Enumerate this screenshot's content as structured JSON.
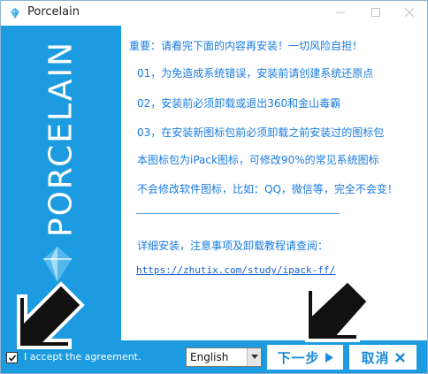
{
  "window": {
    "title": "Porcelain"
  },
  "sidebar": {
    "brand": "PORCELAIN"
  },
  "content": {
    "heading": "重要：请看完下面的内容再安装！一切风险自担！",
    "lines": [
      "01，为免造成系统错误，安装前请创建系统还原点",
      "02，安装前必须卸载或退出360和金山毒霸",
      "03，在安装新图标包前必须卸载之前安装过的图标包",
      "本图标包为iPack图标，可修改90%的常见系统图标",
      "不会修改软件图标，比如：QQ，微信等，完全不会变！"
    ],
    "details": "详细安装，注意事项及卸载教程请查阅：",
    "link": "https://zhutix.com/study/ipack-ff/"
  },
  "footer": {
    "accept_label": "I accept the agreement.",
    "accept_checked": true,
    "language": "English",
    "next_label": "下一步",
    "cancel_label": "取消"
  },
  "icons": {
    "app": "app-logo-icon",
    "minimize": "minimize-icon",
    "maximize": "maximize-icon",
    "close": "close-icon",
    "checkmark": "checkmark-icon",
    "dropdown": "chevron-down-icon",
    "next": "play-triangle-icon",
    "cancel": "x-icon"
  },
  "colors": {
    "accent": "#1d9be0",
    "text_blue": "#1a7be0",
    "link_blue": "#1a5fd0"
  }
}
